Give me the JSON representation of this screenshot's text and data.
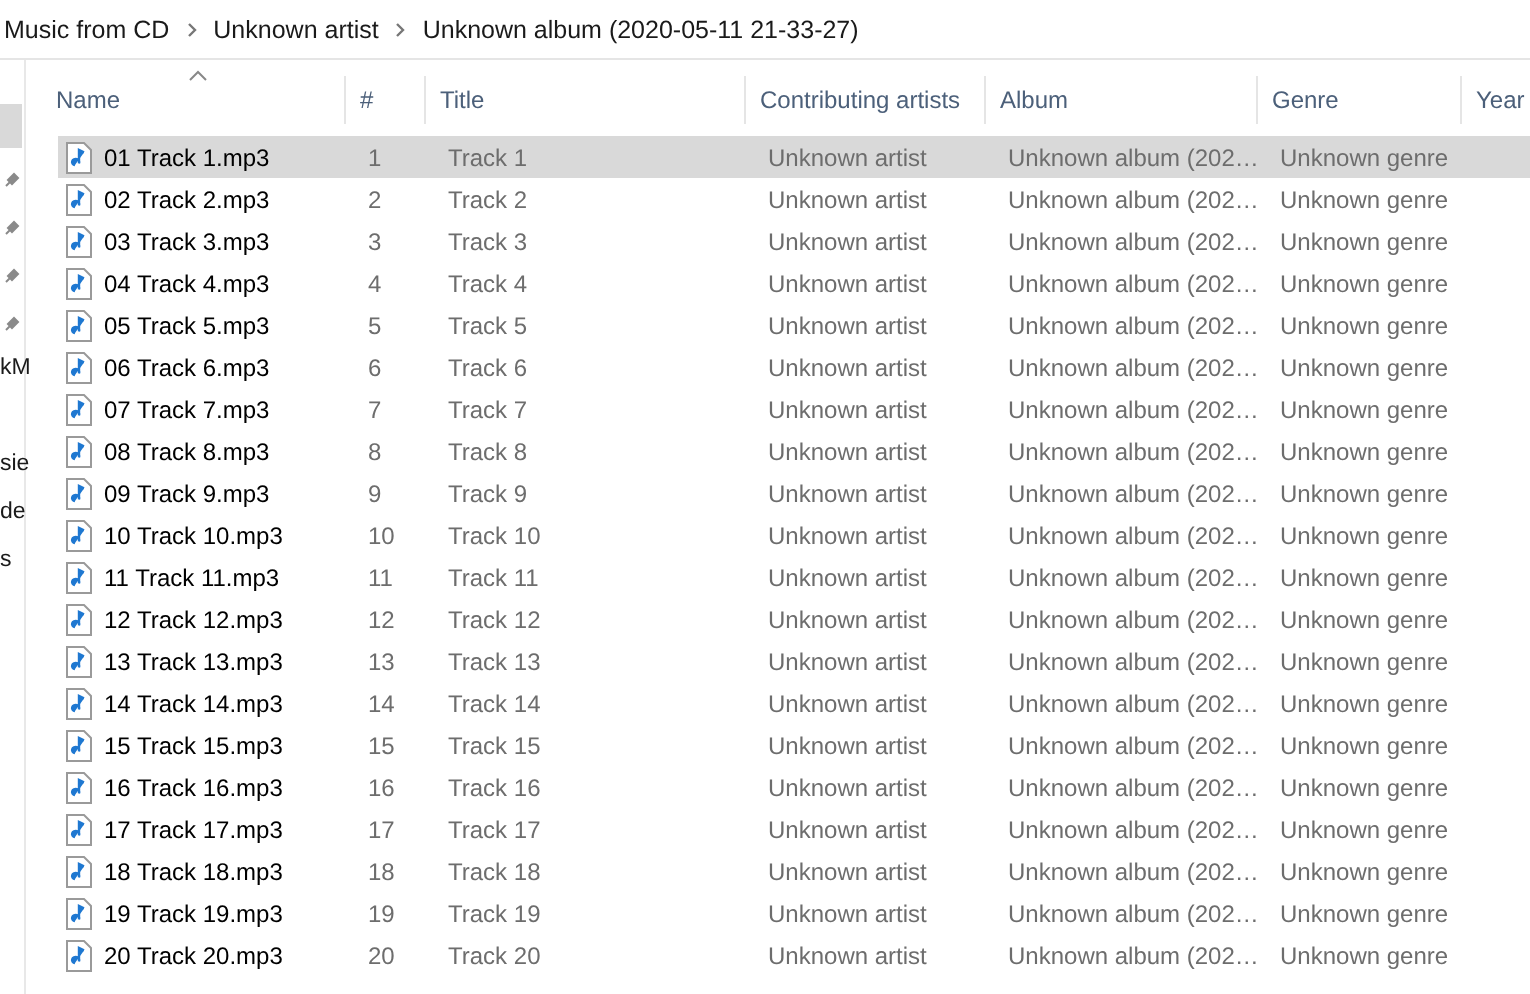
{
  "breadcrumb": [
    "Music from CD",
    "Unknown artist",
    "Unknown album (2020-05-11 21-33-27)"
  ],
  "nav_pane": {
    "items": [
      {
        "selected": true,
        "pinned": false
      },
      {
        "selected": false,
        "pinned": true
      },
      {
        "selected": false,
        "pinned": true
      },
      {
        "selected": false,
        "pinned": true
      },
      {
        "selected": false,
        "pinned": true
      },
      {
        "label": "kM",
        "selected": false,
        "pinned": false
      },
      {
        "label": "sie",
        "selected": false,
        "pinned": false
      },
      {
        "label": "de",
        "selected": false,
        "pinned": false
      },
      {
        "label": "s",
        "selected": false,
        "pinned": false
      }
    ]
  },
  "table": {
    "columns": [
      {
        "label": "Name",
        "sorted": true
      },
      {
        "label": "#",
        "sorted": false
      },
      {
        "label": "Title",
        "sorted": false
      },
      {
        "label": "Contributing artists",
        "sorted": false
      },
      {
        "label": "Album",
        "sorted": false
      },
      {
        "label": "Genre",
        "sorted": false
      },
      {
        "label": "Year",
        "sorted": false
      }
    ],
    "rows": [
      {
        "name": "01 Track 1.mp3",
        "number": "1",
        "title": "Track 1",
        "artist": "Unknown artist",
        "album": "Unknown album (202…",
        "genre": "Unknown genre",
        "selected": true
      },
      {
        "name": "02 Track 2.mp3",
        "number": "2",
        "title": "Track 2",
        "artist": "Unknown artist",
        "album": "Unknown album (202…",
        "genre": "Unknown genre",
        "selected": false
      },
      {
        "name": "03 Track 3.mp3",
        "number": "3",
        "title": "Track 3",
        "artist": "Unknown artist",
        "album": "Unknown album (202…",
        "genre": "Unknown genre",
        "selected": false
      },
      {
        "name": "04 Track 4.mp3",
        "number": "4",
        "title": "Track 4",
        "artist": "Unknown artist",
        "album": "Unknown album (202…",
        "genre": "Unknown genre",
        "selected": false
      },
      {
        "name": "05 Track 5.mp3",
        "number": "5",
        "title": "Track 5",
        "artist": "Unknown artist",
        "album": "Unknown album (202…",
        "genre": "Unknown genre",
        "selected": false
      },
      {
        "name": "06 Track 6.mp3",
        "number": "6",
        "title": "Track 6",
        "artist": "Unknown artist",
        "album": "Unknown album (202…",
        "genre": "Unknown genre",
        "selected": false
      },
      {
        "name": "07 Track 7.mp3",
        "number": "7",
        "title": "Track 7",
        "artist": "Unknown artist",
        "album": "Unknown album (202…",
        "genre": "Unknown genre",
        "selected": false
      },
      {
        "name": "08 Track 8.mp3",
        "number": "8",
        "title": "Track 8",
        "artist": "Unknown artist",
        "album": "Unknown album (202…",
        "genre": "Unknown genre",
        "selected": false
      },
      {
        "name": "09 Track 9.mp3",
        "number": "9",
        "title": "Track 9",
        "artist": "Unknown artist",
        "album": "Unknown album (202…",
        "genre": "Unknown genre",
        "selected": false
      },
      {
        "name": "10 Track 10.mp3",
        "number": "10",
        "title": "Track 10",
        "artist": "Unknown artist",
        "album": "Unknown album (202…",
        "genre": "Unknown genre",
        "selected": false
      },
      {
        "name": "11 Track 11.mp3",
        "number": "11",
        "title": "Track 11",
        "artist": "Unknown artist",
        "album": "Unknown album (202…",
        "genre": "Unknown genre",
        "selected": false
      },
      {
        "name": "12 Track 12.mp3",
        "number": "12",
        "title": "Track 12",
        "artist": "Unknown artist",
        "album": "Unknown album (202…",
        "genre": "Unknown genre",
        "selected": false
      },
      {
        "name": "13 Track 13.mp3",
        "number": "13",
        "title": "Track 13",
        "artist": "Unknown artist",
        "album": "Unknown album (202…",
        "genre": "Unknown genre",
        "selected": false
      },
      {
        "name": "14 Track 14.mp3",
        "number": "14",
        "title": "Track 14",
        "artist": "Unknown artist",
        "album": "Unknown album (202…",
        "genre": "Unknown genre",
        "selected": false
      },
      {
        "name": "15 Track 15.mp3",
        "number": "15",
        "title": "Track 15",
        "artist": "Unknown artist",
        "album": "Unknown album (202…",
        "genre": "Unknown genre",
        "selected": false
      },
      {
        "name": "16 Track 16.mp3",
        "number": "16",
        "title": "Track 16",
        "artist": "Unknown artist",
        "album": "Unknown album (202…",
        "genre": "Unknown genre",
        "selected": false
      },
      {
        "name": "17 Track 17.mp3",
        "number": "17",
        "title": "Track 17",
        "artist": "Unknown artist",
        "album": "Unknown album (202…",
        "genre": "Unknown genre",
        "selected": false
      },
      {
        "name": "18 Track 18.mp3",
        "number": "18",
        "title": "Track 18",
        "artist": "Unknown artist",
        "album": "Unknown album (202…",
        "genre": "Unknown genre",
        "selected": false
      },
      {
        "name": "19 Track 19.mp3",
        "number": "19",
        "title": "Track 19",
        "artist": "Unknown artist",
        "album": "Unknown album (202…",
        "genre": "Unknown genre",
        "selected": false
      },
      {
        "name": "20 Track 20.mp3",
        "number": "20",
        "title": "Track 20",
        "artist": "Unknown artist",
        "album": "Unknown album (202…",
        "genre": "Unknown genre",
        "selected": false
      }
    ]
  }
}
